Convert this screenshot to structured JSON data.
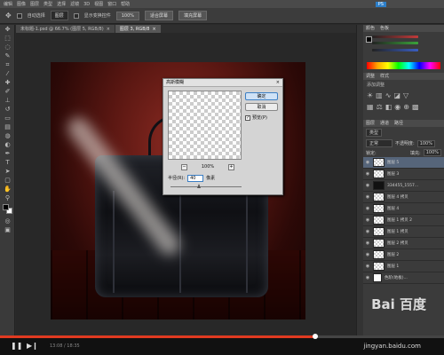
{
  "menubar": {
    "items": [
      "",
      "编辑",
      "图像",
      "图层",
      "类型",
      "选择",
      "滤镜",
      "3D",
      "视图",
      "窗口",
      "帮助",
      "",
      "",
      "",
      "PS"
    ],
    "active": "PS"
  },
  "options": {
    "label1": "自动选择",
    "field1": "图层",
    "label2": "显示变换控件",
    "btn1": "100%",
    "btn2": "适合屏幕",
    "btn3": "填充屏幕"
  },
  "doc_tabs": [
    {
      "label": "未标题-1.psd @ 66.7% (图层 5, RGB/8)",
      "close": "×"
    },
    {
      "label": "图层 3, RGB/8",
      "close": "×"
    }
  ],
  "dialog": {
    "title": "高斯模糊",
    "close": "×",
    "ok": "确定",
    "cancel": "取消",
    "preview_label": "预览(P)",
    "zoom_value": "100%",
    "zoom_out": "−",
    "zoom_in": "+",
    "radius_label": "半径(R):",
    "radius_value": "40",
    "radius_unit": "像素",
    "radius_fraction": 0.4
  },
  "panels": {
    "color_tabs": [
      "颜色",
      "色板"
    ],
    "adjust_tabs": [
      "调整",
      "样式"
    ],
    "adjust_sub": "添加调整",
    "layers_tabs": [
      "图层",
      "通道",
      "路径"
    ],
    "layers_filter": "类型",
    "blend_mode": "正常",
    "opacity_label": "不透明度:",
    "opacity_value": "100%",
    "lock_label": "锁定:",
    "fill_label": "填充:",
    "fill_value": "100%"
  },
  "layers": [
    {
      "name": "图层 5",
      "thumb": "checker",
      "selected": true
    },
    {
      "name": "图层 3",
      "thumb": "checker",
      "selected": false
    },
    {
      "name": "334455_1557...",
      "thumb": "dark",
      "selected": false
    },
    {
      "name": "图层 4 拷贝",
      "thumb": "checker",
      "selected": false
    },
    {
      "name": "图层 4",
      "thumb": "checker",
      "selected": false
    },
    {
      "name": "图层 1 拷贝 2",
      "thumb": "checker",
      "selected": false
    },
    {
      "name": "图层 1 拷贝",
      "thumb": "checker",
      "selected": false
    },
    {
      "name": "图层 2 拷贝",
      "thumb": "checker",
      "selected": false
    },
    {
      "name": "图层 2",
      "thumb": "checker",
      "selected": false
    },
    {
      "name": "图层 1",
      "thumb": "checker",
      "selected": false
    },
    {
      "name": "色阶(地板)...",
      "thumb": "mask",
      "selected": false
    }
  ],
  "colors": {
    "accent": "#2d7fc9",
    "progress": "#e03a21",
    "layer_selected": "#56657a",
    "slider_red": "#c23a3a",
    "slider_green": "#3aa33a",
    "slider_blue": "#3a5ec2"
  },
  "player": {
    "progress_fraction": 0.71,
    "time": "13:08 / 18:35",
    "play_icon": "pause-icon"
  },
  "watermark": {
    "logo": "Bai 百度",
    "url": "jingyan.baidu.com"
  }
}
